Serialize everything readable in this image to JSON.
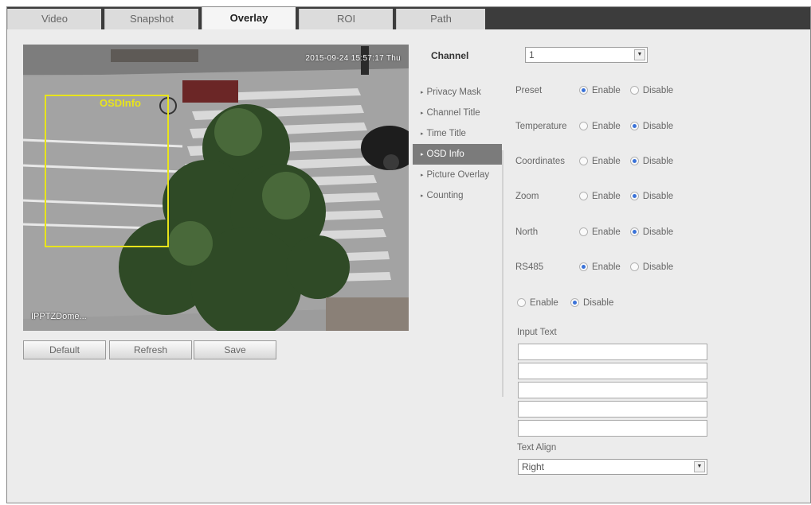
{
  "tabs": [
    {
      "label": "Video",
      "active": false
    },
    {
      "label": "Snapshot",
      "active": false
    },
    {
      "label": "Overlay",
      "active": true
    },
    {
      "label": "ROI",
      "active": false
    },
    {
      "label": "Path",
      "active": false
    }
  ],
  "preview": {
    "timestamp": "2015-09-24 15:57:17 Thu",
    "osd_label": "OSDInfo",
    "model_text": "IPPTZDome..."
  },
  "buttons": {
    "default_label": "Default",
    "refresh_label": "Refresh",
    "save_label": "Save"
  },
  "channel": {
    "label": "Channel",
    "value": "1"
  },
  "submenu": [
    {
      "label": "Privacy Mask",
      "active": false
    },
    {
      "label": "Channel Title",
      "active": false
    },
    {
      "label": "Time Title",
      "active": false
    },
    {
      "label": "OSD Info",
      "active": true
    },
    {
      "label": "Picture Overlay",
      "active": false
    },
    {
      "label": "Counting",
      "active": false
    }
  ],
  "settings": {
    "enable_label": "Enable",
    "disable_label": "Disable",
    "rows": [
      {
        "name": "Preset",
        "selected": "enable"
      },
      {
        "name": "Temperature",
        "selected": "disable"
      },
      {
        "name": "Coordinates",
        "selected": "disable"
      },
      {
        "name": "Zoom",
        "selected": "disable"
      },
      {
        "name": "North",
        "selected": "disable"
      },
      {
        "name": "RS485",
        "selected": "enable"
      }
    ],
    "text_overlay_selected": "disable",
    "input_text_label": "Input Text",
    "text_lines": [
      "",
      "",
      "",
      "",
      ""
    ],
    "text_align_label": "Text Align",
    "text_align_value": "Right"
  },
  "colors": {
    "active_menu": "#7b7b7b",
    "radio_selected": "#3a72d8",
    "osd_box": "#e8e41b",
    "tab_bar": "#3c3c3c"
  }
}
